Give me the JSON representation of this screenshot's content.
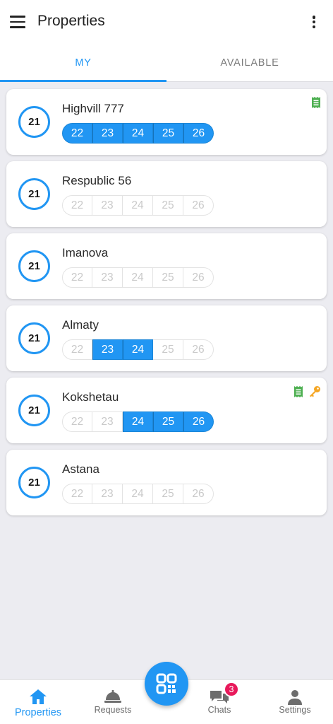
{
  "header": {
    "title": "Properties"
  },
  "tabs": [
    {
      "label": "MY"
    },
    {
      "label": "AVAILABLE"
    }
  ],
  "colors": {
    "accent": "#2196f3",
    "receipt": "#4caf50",
    "key": "#f5a623",
    "badge": "#e8195b"
  },
  "properties": [
    {
      "circle": "21",
      "name": "Highvill 777",
      "days": [
        "22",
        "23",
        "24",
        "25",
        "26"
      ],
      "active_days": [
        "22",
        "23",
        "24",
        "25",
        "26"
      ],
      "icons": [
        "receipt-icon"
      ]
    },
    {
      "circle": "21",
      "name": "Respublic 56",
      "days": [
        "22",
        "23",
        "24",
        "25",
        "26"
      ],
      "active_days": [],
      "icons": []
    },
    {
      "circle": "21",
      "name": "Imanova",
      "days": [
        "22",
        "23",
        "24",
        "25",
        "26"
      ],
      "active_days": [],
      "icons": []
    },
    {
      "circle": "21",
      "name": "Almaty",
      "days": [
        "22",
        "23",
        "24",
        "25",
        "26"
      ],
      "active_days": [
        "23",
        "24"
      ],
      "icons": []
    },
    {
      "circle": "21",
      "name": "Kokshetau",
      "days": [
        "22",
        "23",
        "24",
        "25",
        "26"
      ],
      "active_days": [
        "24",
        "25",
        "26"
      ],
      "icons": [
        "receipt-icon",
        "key-icon"
      ]
    },
    {
      "circle": "21",
      "name": "Astana",
      "days": [
        "22",
        "23",
        "24",
        "25",
        "26"
      ],
      "active_days": [],
      "icons": []
    }
  ],
  "nav": {
    "items": [
      {
        "label": "Properties",
        "icon": "home-icon"
      },
      {
        "label": "Requests",
        "icon": "service-bell-icon"
      },
      {
        "label": "Chats",
        "icon": "chat-icon"
      },
      {
        "label": "Settings",
        "icon": "person-icon"
      }
    ],
    "chats_badge": "3",
    "fab_icon": "qr-code-icon"
  }
}
